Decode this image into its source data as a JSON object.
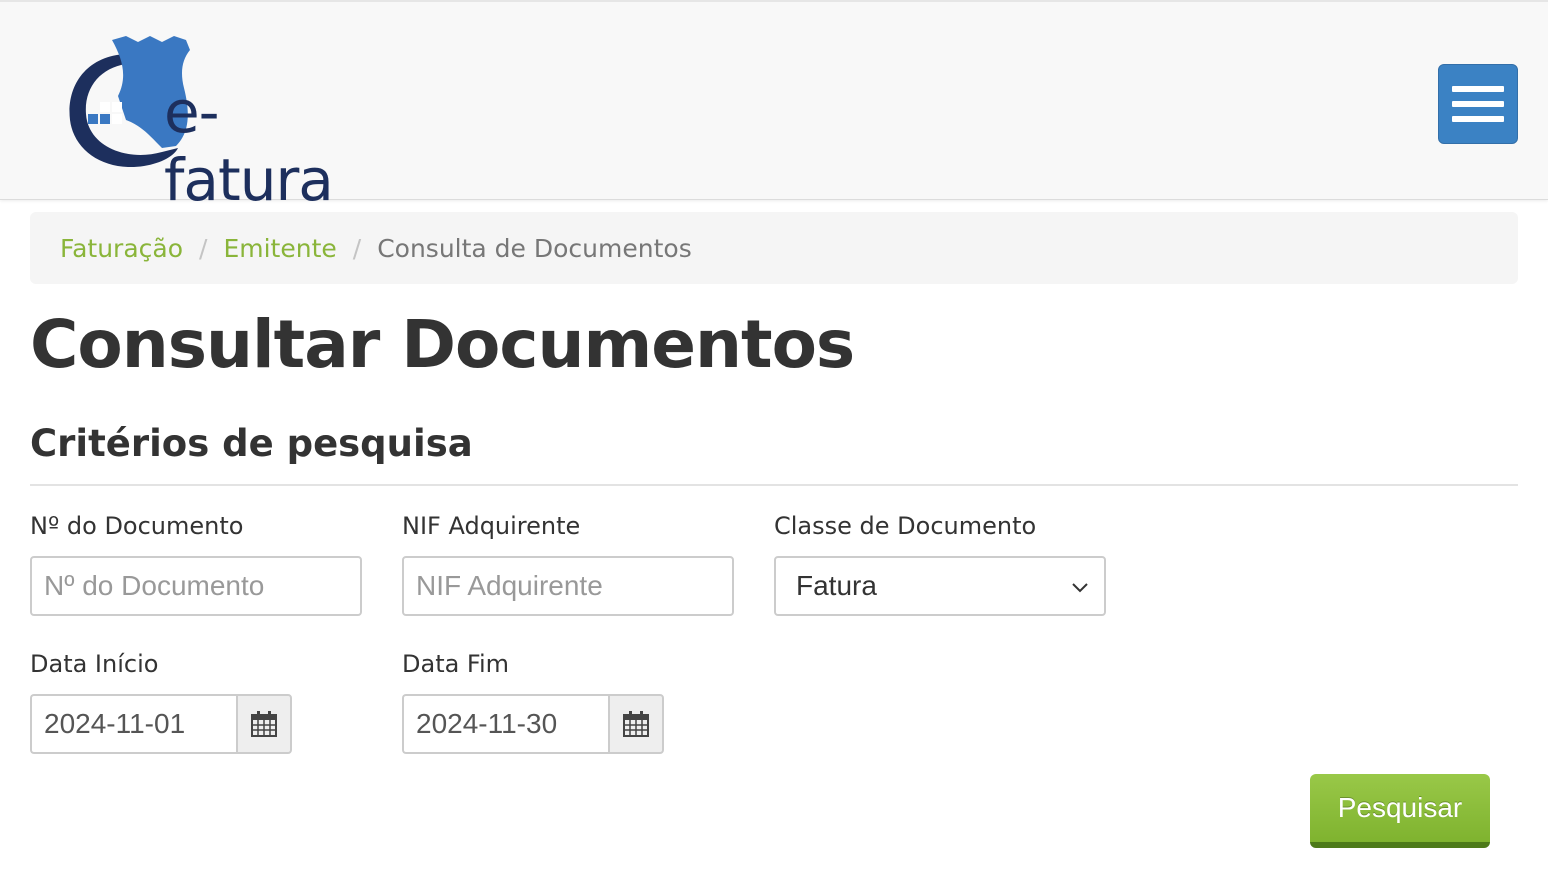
{
  "header": {
    "logo_text": "e-fatura",
    "menu_icon": "hamburger-icon"
  },
  "breadcrumb": {
    "items": [
      "Faturação",
      "Emitente"
    ],
    "current": "Consulta de Documentos",
    "separator": "/"
  },
  "page": {
    "title": "Consultar Documentos",
    "section_title": "Critérios de pesquisa"
  },
  "form": {
    "doc_number": {
      "label": "Nº do Documento",
      "placeholder": "Nº do Documento",
      "value": ""
    },
    "nif": {
      "label": "NIF Adquirente",
      "placeholder": "NIF Adquirente",
      "value": ""
    },
    "doc_class": {
      "label": "Classe de Documento",
      "selected": "Fatura"
    },
    "start_date": {
      "label": "Data Início",
      "value": "2024-11-01"
    },
    "end_date": {
      "label": "Data Fim",
      "value": "2024-11-30"
    },
    "search_label": "Pesquisar"
  },
  "colors": {
    "brand_blue": "#3b82c4",
    "link_green": "#8ab53a",
    "button_green": "#8bbd3c",
    "logo_navy": "#1d2f5d"
  }
}
